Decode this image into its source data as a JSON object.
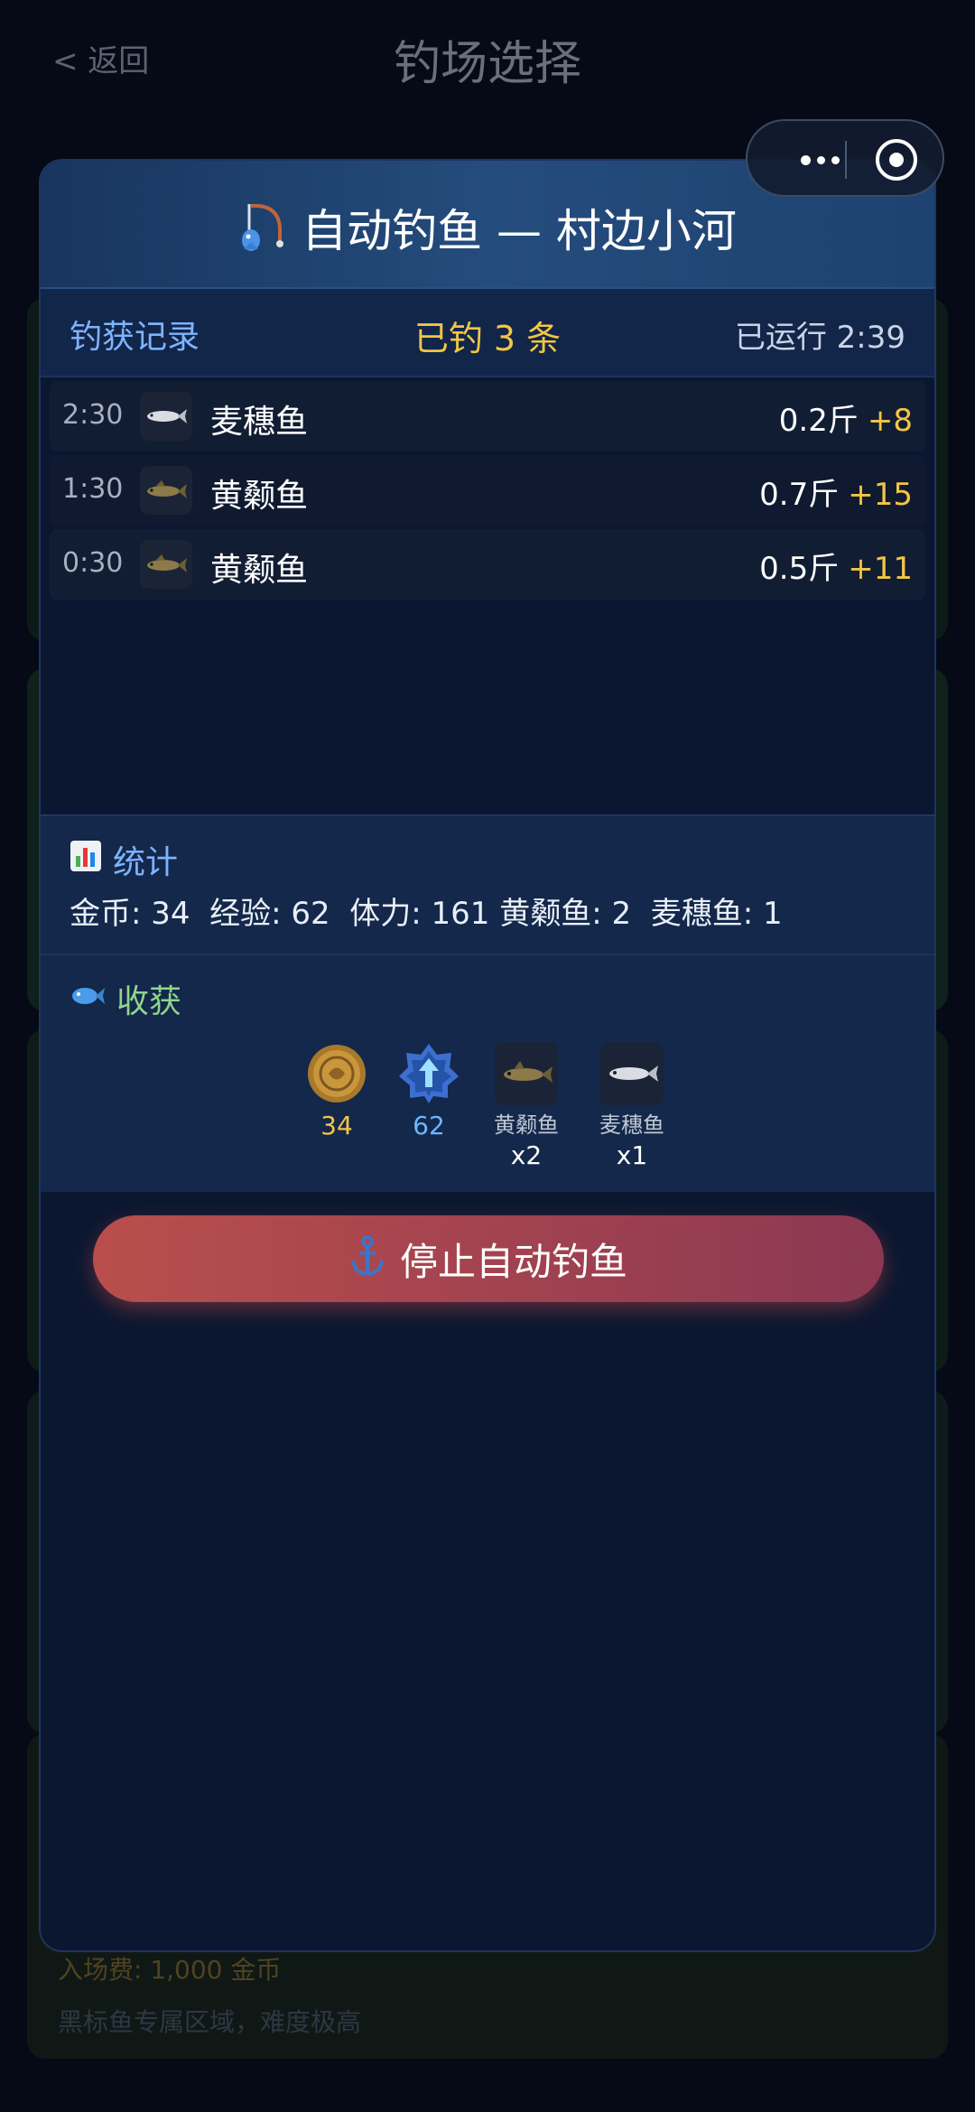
{
  "nav": {
    "back_label": "< 返回",
    "title": "钓场选择"
  },
  "background": {
    "fee": "入场费: 1,000 金币",
    "description": "黑标鱼专属区域，难度极高"
  },
  "capsule": {
    "more_icon": "more-dots-icon",
    "close_icon": "target-close-icon"
  },
  "modal": {
    "title": "自动钓鱼 — 村边小河",
    "title_icon": "fishing-rod-icon",
    "record_label": "钓获记录",
    "caught_count": "已钓 3 条",
    "runtime": "已运行 2:39",
    "records": [
      {
        "time": "2:30",
        "fish": "麦穗鱼",
        "weight": "0.2斤",
        "bonus": "+8",
        "fish_icon": "silver-fish-icon"
      },
      {
        "time": "1:30",
        "fish": "黄颡鱼",
        "weight": "0.7斤",
        "bonus": "+15",
        "fish_icon": "yellow-catfish-icon"
      },
      {
        "time": "0:30",
        "fish": "黄颡鱼",
        "weight": "0.5斤",
        "bonus": "+11",
        "fish_icon": "yellow-catfish-icon"
      }
    ],
    "stats": {
      "title": "统计",
      "icon": "bar-chart-icon",
      "summary": "金币: 34  经验: 62  体力: 161 黄颡鱼: 2  麦穗鱼: 1"
    },
    "harvest": {
      "title": "收获",
      "icon": "fish-icon",
      "items": [
        {
          "icon": "gold-coin-icon",
          "value": "34",
          "color": "#f2c544"
        },
        {
          "icon": "exp-badge-icon",
          "value": "62",
          "color": "#6fb6ff"
        },
        {
          "icon": "yellow-catfish-icon",
          "name": "黄颡鱼",
          "qty": "x2"
        },
        {
          "icon": "silver-fish-icon",
          "name": "麦穗鱼",
          "qty": "x1"
        }
      ]
    },
    "stop_button": {
      "label": "停止自动钓鱼",
      "icon": "anchor-icon"
    }
  }
}
